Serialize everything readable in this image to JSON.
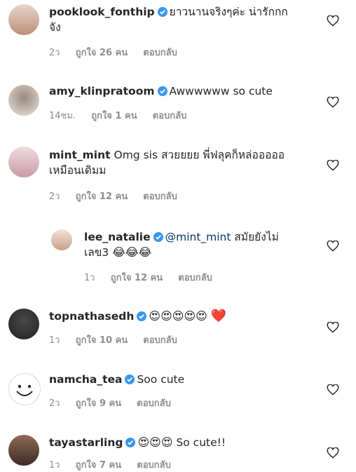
{
  "comments": [
    {
      "username": "pooklook_fonthip",
      "text": "ยาวนานจริงๆค่ะ น่ารักกก",
      "text2": "จัง",
      "time": "2ว",
      "likes": "ถูกใจ 26 คน",
      "reply": "ตอบกลับ"
    },
    {
      "username": "amy_klinpratoom",
      "text": "Awwwwww so cute",
      "time": "14ชม.",
      "likes": "ถูกใจ 1 คน",
      "reply": "ตอบกลับ"
    },
    {
      "username": "mint_mint",
      "text": "Omg sis สวยยยย พี่ฟลุคก็หล่อออออ",
      "text2": "เหมือนเดิมม",
      "time": "2ว",
      "likes": "ถูกใจ 12 คน",
      "reply": "ตอบกลับ"
    },
    {
      "username": "lee_natalie",
      "mention": "@mint_mint",
      "text": "สมัยยังไม่",
      "text2": "เลข3",
      "emoji": "😂😂😂",
      "time": "1ว",
      "likes": "ถูกใจ 12 คน",
      "reply": "ตอบกลับ"
    },
    {
      "username": "topnathasedh",
      "emoji": "😍😍😍😍😍",
      "heart": "❤️",
      "time": "1ว",
      "likes": "ถูกใจ 10 คน",
      "reply": "ตอบกลับ"
    },
    {
      "username": "namcha_tea",
      "text": "Soo cute",
      "time": "2ว",
      "likes": "ถูกใจ 9 คน",
      "reply": "ตอบกลับ"
    },
    {
      "username": "tayastarling",
      "emoji": "😍😍😍",
      "text": "So cute!!",
      "time": "1ว",
      "likes": "ถูกใจ 7 คน",
      "reply": "ตอบกลับ"
    }
  ],
  "colors": {
    "verified": "#3897f0",
    "secondary": "#8e8e8e",
    "link": "#00376b"
  }
}
